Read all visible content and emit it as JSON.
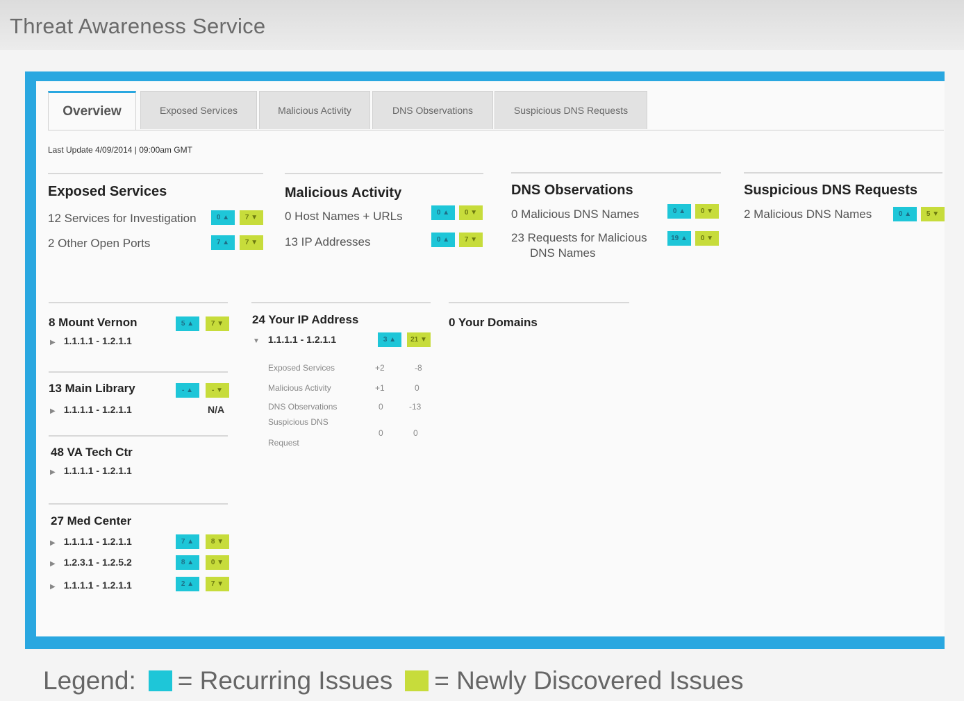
{
  "app": {
    "title": "Threat Awareness Service"
  },
  "tabs": [
    {
      "label": "Overview",
      "active": true
    },
    {
      "label": "Exposed Services"
    },
    {
      "label": "Malicious Activity"
    },
    {
      "label": "DNS Observations"
    },
    {
      "label": "Suspicious DNS Requests"
    }
  ],
  "last_update": "Last Update 4/09/2014 | 09:00am GMT",
  "summary": {
    "exposed": {
      "title": "Exposed Services",
      "rows": [
        {
          "text": "12 Services for Investigation",
          "rec": "0 ▲",
          "new": "7 ▼"
        },
        {
          "text": "2   Other Open Ports",
          "rec": "7 ▲",
          "new": "7 ▼"
        }
      ]
    },
    "malicious": {
      "title": "Malicious Activity",
      "rows": [
        {
          "text": "0   Host Names + URLs",
          "rec": "0 ▲",
          "new": "0 ▼"
        },
        {
          "text": "13  IP Addresses",
          "rec": "0 ▲",
          "new": "7 ▼"
        }
      ]
    },
    "dns": {
      "title": "DNS Observations",
      "rows": [
        {
          "text": "0   Malicious DNS Names",
          "rec": "0 ▲",
          "new": "0 ▼"
        },
        {
          "text": "23  Requests for Malicious",
          "text2": "DNS Names",
          "rec": "19 ▲",
          "new": "0 ▼"
        }
      ]
    },
    "suspicious": {
      "title": "Suspicious DNS Requests",
      "rows": [
        {
          "text": "2   Malicious DNS Names",
          "rec": "0 ▲",
          "new": "5 ▼"
        }
      ]
    }
  },
  "sites": {
    "mount_vernon": {
      "title": "8 Mount Vernon",
      "ip": "1.1.1.1 - 1.2.1.1",
      "rec": "5 ▲",
      "new": "7 ▼"
    },
    "main_library": {
      "title": "13 Main Library",
      "ip": "1.1.1.1 - 1.2.1.1",
      "rec": "- ▲",
      "new": "- ▼",
      "na": "N/A"
    },
    "va_tech": {
      "title": "48 VA Tech Ctr",
      "ip": "1.1.1.1 - 1.2.1.1"
    },
    "med_center": {
      "title": "27 Med Center",
      "rows": [
        {
          "ip": "1.1.1.1 - 1.2.1.1",
          "rec": "7 ▲",
          "new": "8 ▼"
        },
        {
          "ip": "1.2.3.1 - 1.2.5.2",
          "rec": "8 ▲",
          "new": "0 ▼"
        },
        {
          "ip": "1.1.1.1 - 1.2.1.1",
          "rec": "2 ▲",
          "new": "7 ▼"
        }
      ]
    }
  },
  "your_ip": {
    "title": "24 Your IP Address",
    "ip": "1.1.1.1 - 1.2.1.1",
    "rec": "3 ▲",
    "new": "21 ▼",
    "details": [
      {
        "label": "Exposed Services",
        "a": "+2",
        "b": "-8"
      },
      {
        "label": "Malicious Activity",
        "a": "+1",
        "b": "0"
      },
      {
        "label": "DNS Observations",
        "a": "0",
        "b": "-13"
      },
      {
        "label": "Suspicious DNS",
        "label2": "Request",
        "a": "0",
        "b": "0"
      }
    ]
  },
  "your_domains": {
    "title": "0   Your Domains"
  },
  "legend": {
    "label": "Legend:",
    "recurring": "= Recurring Issues",
    "new": "= Newly Discovered Issues",
    "colors": {
      "recurring": "#1ec6d8",
      "new": "#c7dc3b"
    }
  }
}
